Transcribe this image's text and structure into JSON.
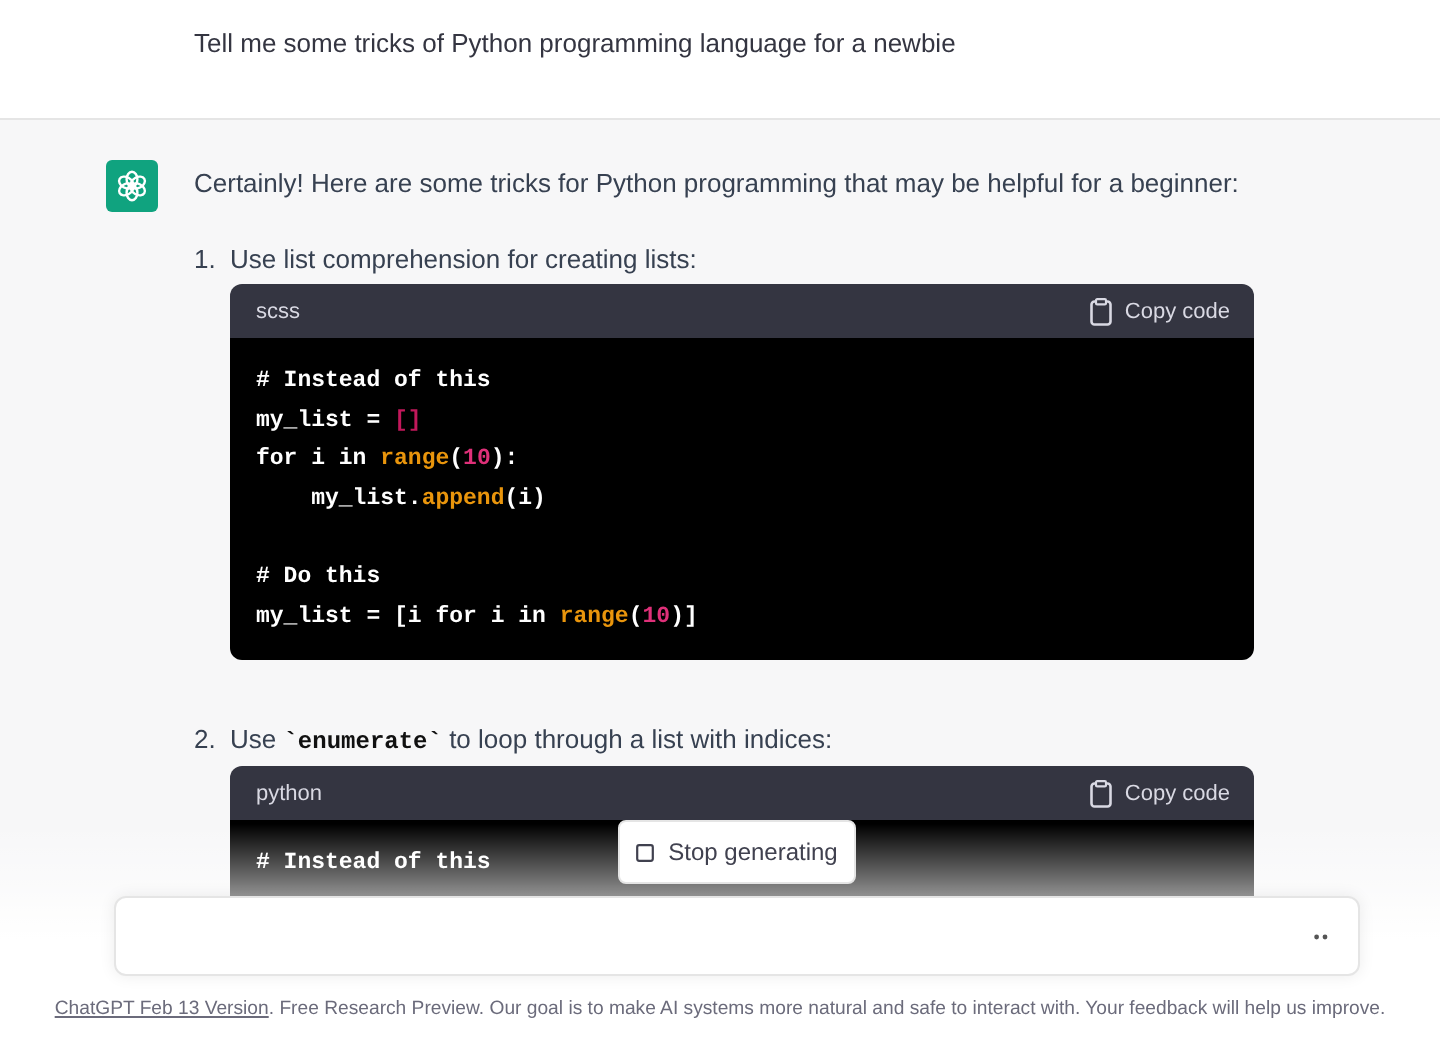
{
  "user_message": {
    "text": "Tell me some tricks of Python programming language for a newbie"
  },
  "assistant_message": {
    "intro": "Certainly! Here are some tricks for Python programming that may be helpful for a beginner:",
    "items": [
      {
        "number": "1.",
        "segments": [
          {
            "kind": "text",
            "text": "Use list comprehension for creating lists:"
          }
        ],
        "code_block": {
          "language": "scss",
          "copy_label": "Copy code",
          "lines": [
            {
              "kind": "code",
              "tokens": [
                {
                  "kind": "comment",
                  "text": "# Instead of this"
                }
              ]
            },
            {
              "kind": "code",
              "tokens": [
                {
                  "kind": "plain",
                  "text": "my_list = "
                },
                {
                  "kind": "bracket",
                  "text": "[]"
                }
              ]
            },
            {
              "kind": "code",
              "tokens": [
                {
                  "kind": "plain",
                  "text": "for i in "
                },
                {
                  "kind": "builtin",
                  "text": "range"
                },
                {
                  "kind": "plain",
                  "text": "("
                },
                {
                  "kind": "number",
                  "text": "10"
                },
                {
                  "kind": "plain",
                  "text": "):"
                }
              ]
            },
            {
              "kind": "code",
              "tokens": [
                {
                  "kind": "plain",
                  "text": "    my_list."
                },
                {
                  "kind": "builtin",
                  "text": "append"
                },
                {
                  "kind": "plain",
                  "text": "(i)"
                }
              ]
            },
            {
              "kind": "blank"
            },
            {
              "kind": "code",
              "tokens": [
                {
                  "kind": "comment",
                  "text": "# Do this"
                }
              ]
            },
            {
              "kind": "code",
              "tokens": [
                {
                  "kind": "plain",
                  "text": "my_list = [i for i in "
                },
                {
                  "kind": "builtin",
                  "text": "range"
                },
                {
                  "kind": "plain",
                  "text": "("
                },
                {
                  "kind": "number",
                  "text": "10"
                },
                {
                  "kind": "plain",
                  "text": ")]"
                }
              ]
            }
          ]
        }
      },
      {
        "number": "2.",
        "segments": [
          {
            "kind": "text",
            "text": "Use "
          },
          {
            "kind": "code",
            "text": "`enumerate`"
          },
          {
            "kind": "text",
            "text": " to loop through a list with indices:"
          }
        ],
        "code_block": {
          "language": "python",
          "copy_label": "Copy code",
          "lines": [
            {
              "kind": "code",
              "tokens": [
                {
                  "kind": "comment",
                  "text": "# Instead of this"
                }
              ]
            }
          ]
        }
      }
    ]
  },
  "stop_button": {
    "label": "Stop generating"
  },
  "footer": {
    "link": "ChatGPT Feb 13 Version",
    "text": ". Free Research Preview. Our goal is to make AI systems more natural and safe to interact with. Your feedback will help us improve."
  }
}
